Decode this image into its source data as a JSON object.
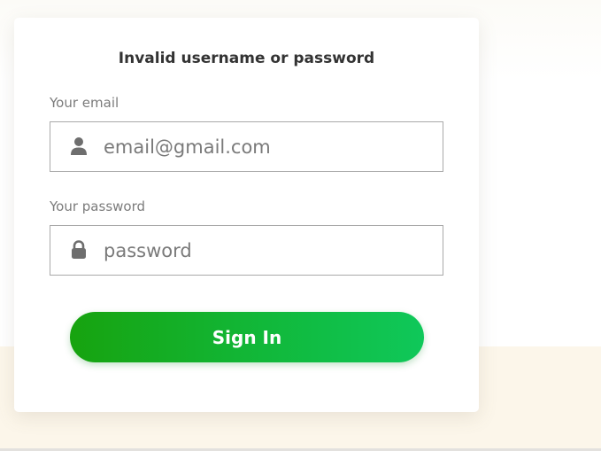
{
  "login": {
    "error_message": "Invalid username or password",
    "email": {
      "label": "Your email",
      "placeholder": "email@gmail.com",
      "value": "",
      "icon": "user-icon"
    },
    "password": {
      "label": "Your password",
      "placeholder": "password",
      "value": "",
      "icon": "lock-icon"
    },
    "submit_label": "Sign In"
  },
  "colors": {
    "button_gradient_start": "#17a30f",
    "button_gradient_end": "#0fc85a",
    "error_text": "#333333",
    "label_text": "#7c7c7c",
    "bottom_band": "#fcf6ea"
  }
}
